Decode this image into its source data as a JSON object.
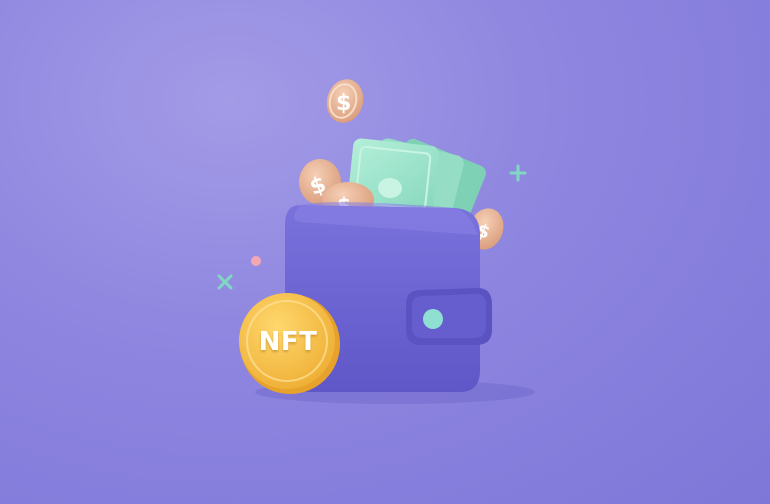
{
  "illustration": {
    "coin_label": "NFT",
    "coin_symbol": "$"
  },
  "colors": {
    "background": "#8d85df",
    "wallet": "#6f67d4",
    "wallet_dark": "#5b53c2",
    "cash": "#9fe3c9",
    "gold_coin": "#f6c14f",
    "copper_coin": "#e9b89a",
    "sparkle_mint": "#7fd9c2",
    "sparkle_pink": "#f3a7b5"
  },
  "icons": [
    "wallet-icon",
    "cash-icon",
    "dollar-coin-icon",
    "nft-coin-icon",
    "sparkle-icon"
  ]
}
